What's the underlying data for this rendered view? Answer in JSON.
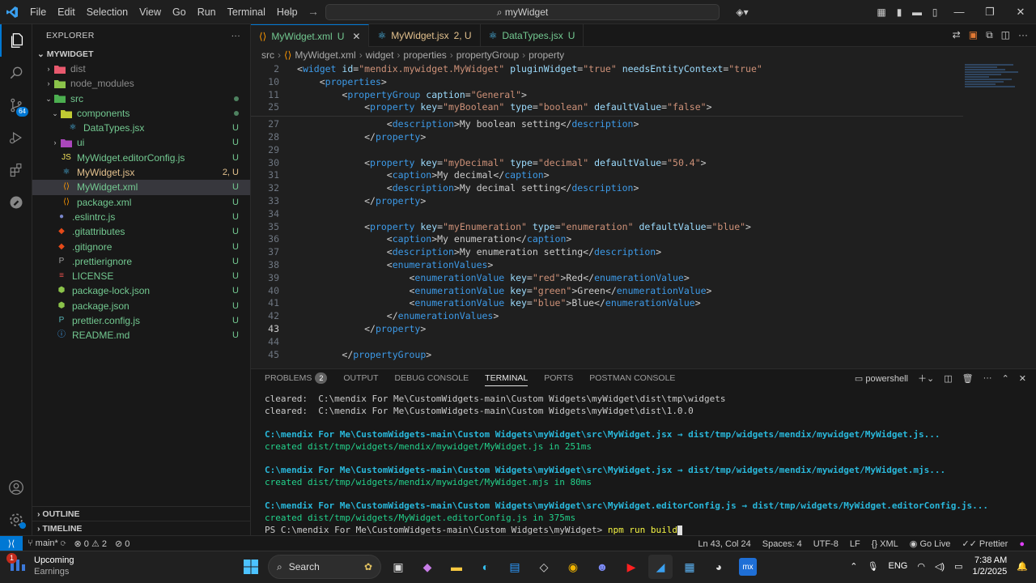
{
  "titlebar": {
    "menu": [
      "File",
      "Edit",
      "Selection",
      "View",
      "Go",
      "Run",
      "Terminal",
      "Help"
    ],
    "search": "myWidget"
  },
  "explorer": {
    "title": "EXPLORER",
    "root": "MYWIDGET",
    "items": [
      {
        "label": "dist",
        "status": ""
      },
      {
        "label": "node_modules",
        "status": ""
      },
      {
        "label": "src",
        "status": ""
      },
      {
        "label": "components",
        "status": ""
      },
      {
        "label": "DataTypes.jsx",
        "status": "U"
      },
      {
        "label": "ui",
        "status": "U"
      },
      {
        "label": "MyWidget.editorConfig.js",
        "status": "U"
      },
      {
        "label": "MyWidget.jsx",
        "status": "2, U"
      },
      {
        "label": "MyWidget.xml",
        "status": "U"
      },
      {
        "label": "package.xml",
        "status": "U"
      },
      {
        "label": ".eslintrc.js",
        "status": "U"
      },
      {
        "label": ".gitattributes",
        "status": "U"
      },
      {
        "label": ".gitignore",
        "status": "U"
      },
      {
        "label": ".prettierignore",
        "status": "U"
      },
      {
        "label": "LICENSE",
        "status": "U"
      },
      {
        "label": "package-lock.json",
        "status": "U"
      },
      {
        "label": "package.json",
        "status": "U"
      },
      {
        "label": "prettier.config.js",
        "status": "U"
      },
      {
        "label": "README.md",
        "status": "U"
      }
    ],
    "outline": "OUTLINE",
    "timeline": "TIMELINE"
  },
  "tabs": [
    {
      "label": "MyWidget.xml",
      "status": "U"
    },
    {
      "label": "MyWidget.jsx",
      "status": "2, U"
    },
    {
      "label": "DataTypes.jsx",
      "status": "U"
    }
  ],
  "breadcrumb": [
    "src",
    "MyWidget.xml",
    "widget",
    "properties",
    "propertyGroup",
    "property"
  ],
  "code": {
    "lines": [
      {
        "n": "2",
        "t": "<widget id=\"mendix.mywidget.MyWidget\" pluginWidget=\"true\" needsEntityContext=\"true\""
      },
      {
        "n": "10",
        "t": "    <properties>"
      },
      {
        "n": "11",
        "t": "        <propertyGroup caption=\"General\">"
      },
      {
        "n": "25",
        "t": "            <property key=\"myBoolean\" type=\"boolean\" defaultValue=\"false\">"
      },
      {
        "n": "27",
        "t": "                <description>My boolean setting</description>"
      },
      {
        "n": "28",
        "t": "            </property>"
      },
      {
        "n": "29",
        "t": ""
      },
      {
        "n": "30",
        "t": "            <property key=\"myDecimal\" type=\"decimal\" defaultValue=\"50.4\">"
      },
      {
        "n": "31",
        "t": "                <caption>My decimal</caption>"
      },
      {
        "n": "32",
        "t": "                <description>My decimal setting</description>"
      },
      {
        "n": "33",
        "t": "            </property>"
      },
      {
        "n": "34",
        "t": ""
      },
      {
        "n": "35",
        "t": "            <property key=\"myEnumeration\" type=\"enumeration\" defaultValue=\"blue\">"
      },
      {
        "n": "36",
        "t": "                <caption>My enumeration</caption>"
      },
      {
        "n": "37",
        "t": "                <description>My enumeration setting</description>"
      },
      {
        "n": "38",
        "t": "                <enumerationValues>"
      },
      {
        "n": "39",
        "t": "                    <enumerationValue key=\"red\">Red</enumerationValue>"
      },
      {
        "n": "40",
        "t": "                    <enumerationValue key=\"green\">Green</enumerationValue>"
      },
      {
        "n": "41",
        "t": "                    <enumerationValue key=\"blue\">Blue</enumerationValue>"
      },
      {
        "n": "42",
        "t": "                </enumerationValues>"
      },
      {
        "n": "43",
        "t": "            </property>"
      },
      {
        "n": "44",
        "t": ""
      },
      {
        "n": "45",
        "t": "        </propertyGroup>"
      }
    ]
  },
  "panel": {
    "tabs": [
      "PROBLEMS",
      "OUTPUT",
      "DEBUG CONSOLE",
      "TERMINAL",
      "PORTS",
      "POSTMAN CONSOLE"
    ],
    "problems_count": "2",
    "shell": "powershell",
    "terminal": [
      "cleared:  C:\\mendix For Me\\CustomWidgets-main\\Custom Widgets\\myWidget\\dist\\tmp\\widgets",
      "cleared:  C:\\mendix For Me\\CustomWidgets-main\\Custom Widgets\\myWidget\\dist\\1.0.0",
      "",
      "C:\\mendix For Me\\CustomWidgets-main\\Custom Widgets\\myWidget\\src\\MyWidget.jsx → dist/tmp/widgets/mendix/mywidget/MyWidget.js...",
      "created dist/tmp/widgets/mendix/mywidget/MyWidget.js in 251ms",
      "",
      "C:\\mendix For Me\\CustomWidgets-main\\Custom Widgets\\myWidget\\src\\MyWidget.jsx → dist/tmp/widgets/mendix/mywidget/MyWidget.mjs...",
      "created dist/tmp/widgets/mendix/mywidget/MyWidget.mjs in 80ms",
      "",
      "C:\\mendix For Me\\CustomWidgets-main\\Custom Widgets\\myWidget\\src\\MyWidget.editorConfig.js → dist/tmp/widgets/MyWidget.editorConfig.js...",
      "created dist/tmp/widgets/MyWidget.editorConfig.js in 375ms"
    ],
    "prompt": "PS C:\\mendix For Me\\CustomWidgets-main\\Custom Widgets\\myWidget>",
    "command": "npm run build"
  },
  "statusbar": {
    "branch": "main*",
    "errors": "0",
    "warnings": "2",
    "ports": "0",
    "position": "Ln 43, Col 24",
    "spaces": "Spaces: 4",
    "encoding": "UTF-8",
    "eol": "LF",
    "language": "XML",
    "golive": "Go Live",
    "prettier": "Prettier"
  },
  "taskbar": {
    "weather_title": "Upcoming",
    "weather_sub": "Earnings",
    "weather_badge": "1",
    "search": "Search",
    "lang": "ENG",
    "time": "7:38 AM",
    "date": "1/2/2025"
  }
}
